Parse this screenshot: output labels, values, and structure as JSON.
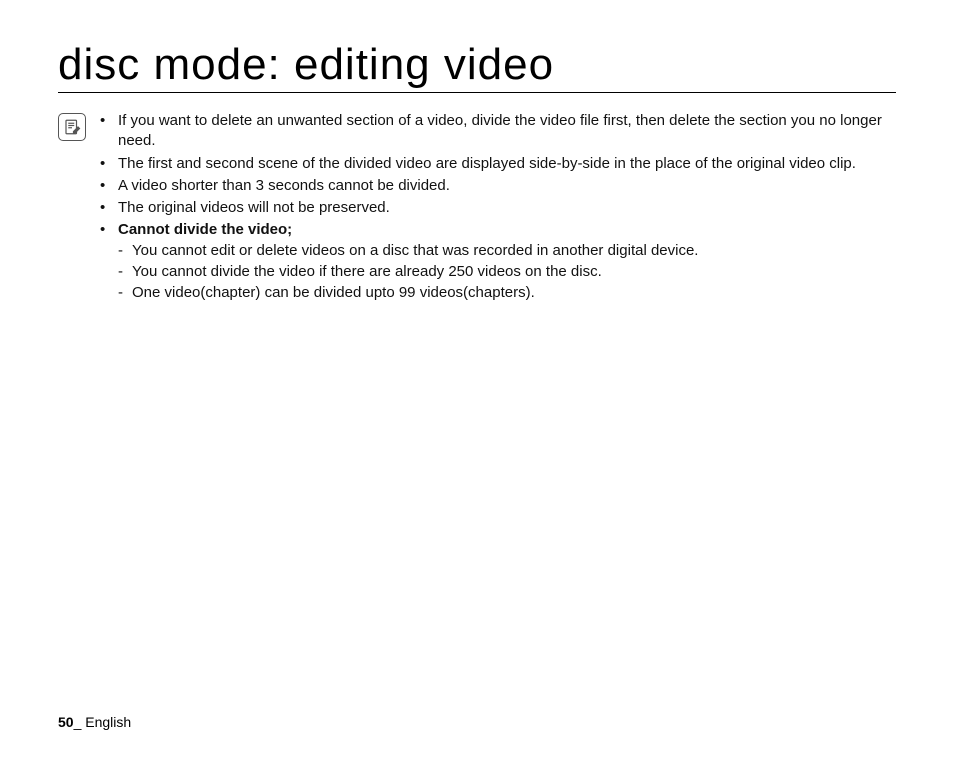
{
  "title": "disc mode: editing video",
  "note_icon": "edit-note-icon",
  "bullets": {
    "b1": "If you want to delete an unwanted section of a video, divide the video file first, then delete the section you no longer need.",
    "b2": "The first and second scene of the divided video are displayed side-by-side in the place of the original video clip.",
    "b3": "A video shorter than 3 seconds cannot be divided.",
    "b4": "The original videos will not be preserved.",
    "b5": "Cannot divide the video;",
    "sub": {
      "s1": "You cannot edit or delete videos on a disc that was recorded in another digital device.",
      "s2": "You cannot divide the video if there are already 250 videos on the disc.",
      "s3": "One video(chapter) can be divided upto 99 videos(chapters)."
    }
  },
  "footer": {
    "page": "50",
    "sep": "_ ",
    "lang": "English"
  }
}
